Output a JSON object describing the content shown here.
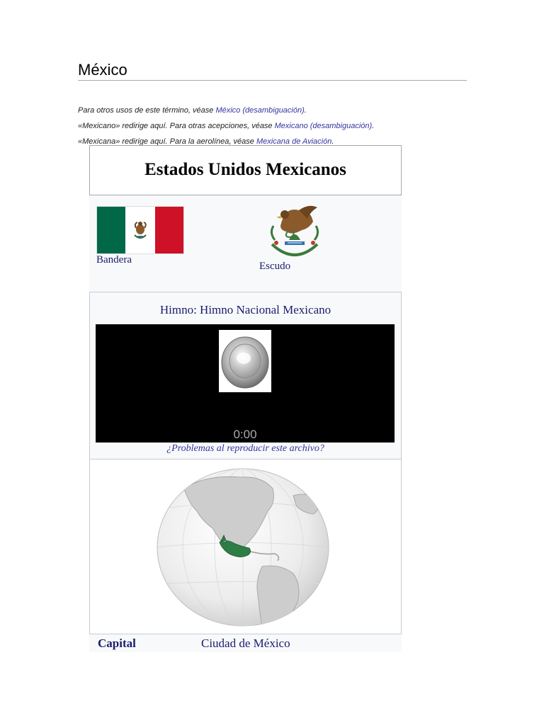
{
  "page": {
    "title": "México"
  },
  "hatnotes": [
    {
      "prefix": "Para otros usos de este término, véase ",
      "link": "México (desambiguación)",
      "suffix": "."
    },
    {
      "prefix": "«Mexicano» redirige aquí. Para otras acepciones, véase ",
      "link": "Mexicano (desambiguación)",
      "suffix": "."
    },
    {
      "prefix": "«Mexicana» redirige aquí. Para la aerolínea, véase ",
      "link": "Mexicana de Aviación",
      "suffix": "."
    }
  ],
  "infobox": {
    "heading": "Estados Unidos Mexicanos",
    "flag_label": "Bandera",
    "coat_label": "Escudo",
    "anthem_title": "Himno: Himno Nacional Mexicano",
    "player_time": "0:00",
    "problem_link": "¿Problemas al reproducir este archivo?",
    "capital_label": "Capital",
    "capital_value": "Ciudad de México"
  },
  "colors": {
    "link": "#3434a0",
    "flag_green": "#006847",
    "flag_red": "#ce1126",
    "highlight_green": "#2e7d46"
  },
  "icons": {
    "speaker": "speaker-icon",
    "coat": "coat-of-arms-icon",
    "globe": "globe-map-icon"
  }
}
